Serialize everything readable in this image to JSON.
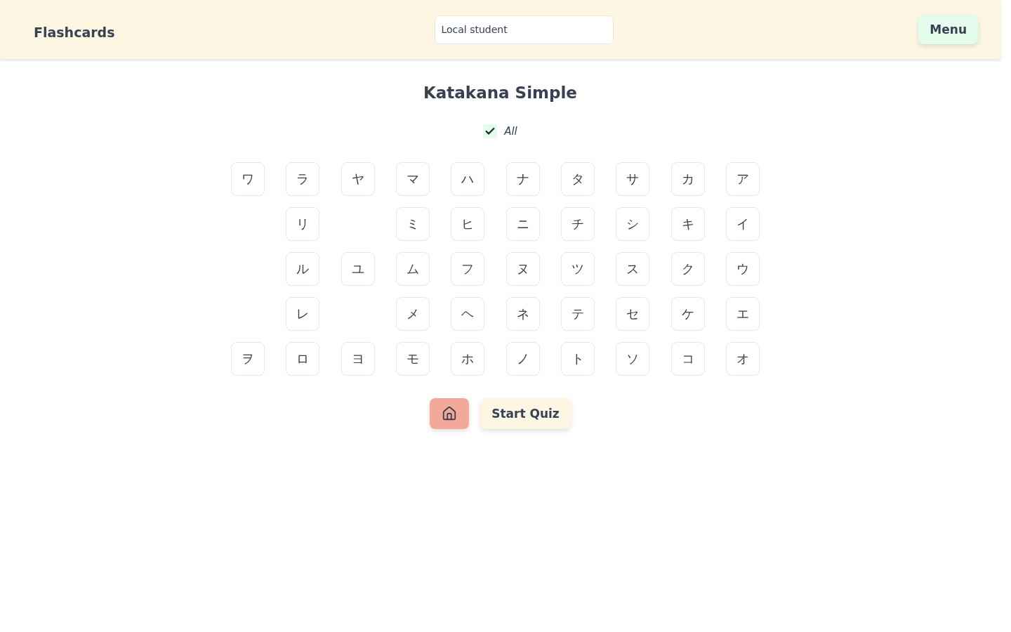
{
  "header": {
    "title": "Flashcards",
    "student_field": {
      "value": "Local student"
    },
    "menu_button": "Menu"
  },
  "page": {
    "title": "Katakana Simple",
    "select_all": {
      "label": "All",
      "checked": true
    }
  },
  "kana_grid": {
    "rows": [
      {
        "cells": [
          {
            "kind": "kana",
            "kana": "ワ"
          },
          {
            "kind": "kana",
            "kana": "ラ"
          },
          {
            "kind": "kana",
            "kana": "ヤ"
          },
          {
            "kind": "kana",
            "kana": "マ"
          },
          {
            "kind": "kana",
            "kana": "ハ"
          },
          {
            "kind": "kana",
            "kana": "ナ"
          },
          {
            "kind": "kana",
            "kana": "タ"
          },
          {
            "kind": "kana",
            "kana": "サ"
          },
          {
            "kind": "kana",
            "kana": "カ"
          },
          {
            "kind": "kana",
            "kana": "ア"
          }
        ]
      },
      {
        "cells": [
          {
            "kind": "blank"
          },
          {
            "kind": "kana",
            "kana": "リ"
          },
          {
            "kind": "blank"
          },
          {
            "kind": "kana",
            "kana": "ミ"
          },
          {
            "kind": "kana",
            "kana": "ヒ"
          },
          {
            "kind": "kana",
            "kana": "ニ"
          },
          {
            "kind": "kana",
            "kana": "チ"
          },
          {
            "kind": "kana",
            "kana": "シ"
          },
          {
            "kind": "kana",
            "kana": "キ"
          },
          {
            "kind": "kana",
            "kana": "イ"
          }
        ]
      },
      {
        "cells": [
          {
            "kind": "blank"
          },
          {
            "kind": "kana",
            "kana": "ル"
          },
          {
            "kind": "kana",
            "kana": "ユ"
          },
          {
            "kind": "kana",
            "kana": "ム"
          },
          {
            "kind": "kana",
            "kana": "フ"
          },
          {
            "kind": "kana",
            "kana": "ヌ"
          },
          {
            "kind": "kana",
            "kana": "ツ"
          },
          {
            "kind": "kana",
            "kana": "ス"
          },
          {
            "kind": "kana",
            "kana": "ク"
          },
          {
            "kind": "kana",
            "kana": "ウ"
          }
        ]
      },
      {
        "cells": [
          {
            "kind": "blank"
          },
          {
            "kind": "kana",
            "kana": "レ"
          },
          {
            "kind": "blank"
          },
          {
            "kind": "kana",
            "kana": "メ"
          },
          {
            "kind": "kana",
            "kana": "ヘ"
          },
          {
            "kind": "kana",
            "kana": "ネ"
          },
          {
            "kind": "kana",
            "kana": "テ"
          },
          {
            "kind": "kana",
            "kana": "セ"
          },
          {
            "kind": "kana",
            "kana": "ケ"
          },
          {
            "kind": "kana",
            "kana": "エ"
          }
        ]
      },
      {
        "cells": [
          {
            "kind": "kana",
            "kana": "ヲ"
          },
          {
            "kind": "kana",
            "kana": "ロ"
          },
          {
            "kind": "kana",
            "kana": "ヨ"
          },
          {
            "kind": "kana",
            "kana": "モ"
          },
          {
            "kind": "kana",
            "kana": "ホ"
          },
          {
            "kind": "kana",
            "kana": "ノ"
          },
          {
            "kind": "kana",
            "kana": "ト"
          },
          {
            "kind": "kana",
            "kana": "ソ"
          },
          {
            "kind": "kana",
            "kana": "コ"
          },
          {
            "kind": "kana",
            "kana": "オ"
          }
        ]
      }
    ]
  },
  "actions": {
    "start_quiz": "Start Quiz"
  }
}
